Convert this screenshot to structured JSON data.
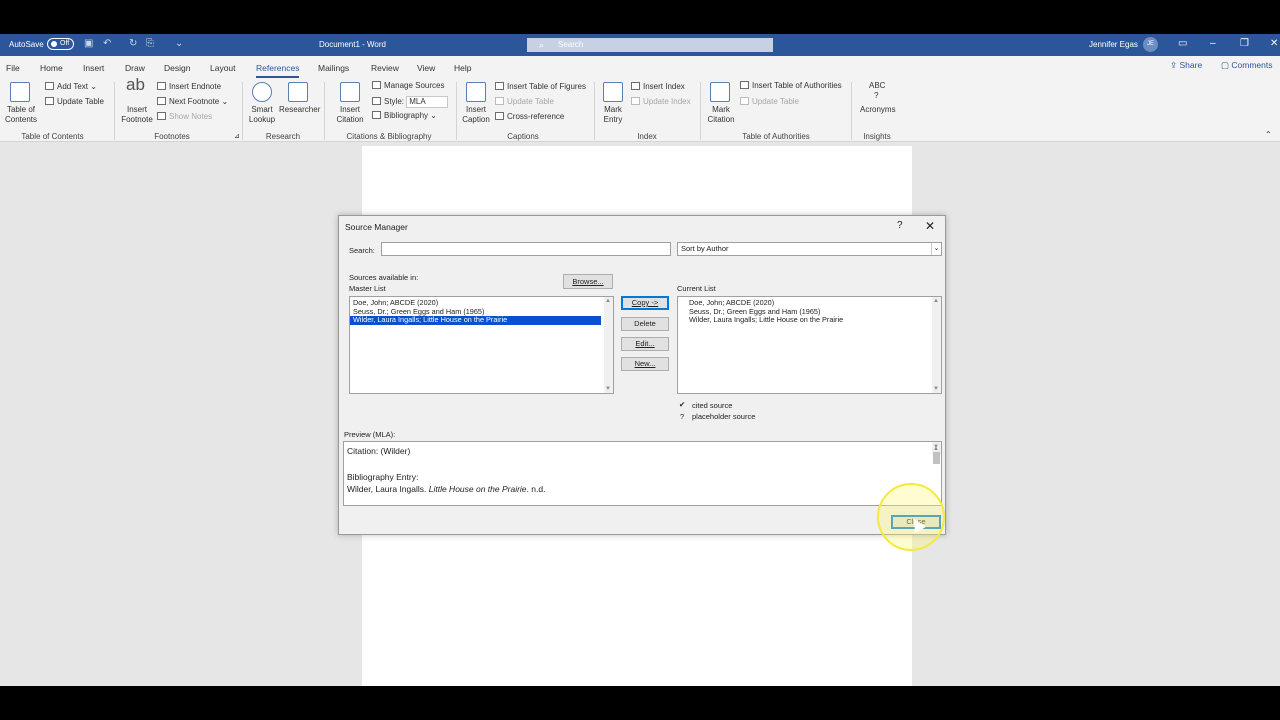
{
  "titlebar": {
    "autosave_label": "AutoSave",
    "autosave_state": "Off",
    "document_title": "Document1  -  Word",
    "search_placeholder": "Search",
    "user_name": "Jennifer Egas",
    "user_initials": "JE"
  },
  "menu": {
    "items": [
      "File",
      "Home",
      "Insert",
      "Draw",
      "Design",
      "Layout",
      "References",
      "Mailings",
      "Review",
      "View",
      "Help"
    ],
    "active": "References",
    "share": "Share",
    "comments": "Comments"
  },
  "ribbon": {
    "toc": {
      "big": "Table of Contents",
      "add_text": "Add Text",
      "update_table": "Update Table",
      "group": "Table of Contents"
    },
    "footnotes": {
      "insert_footnote": "Insert Footnote",
      "insert_endnote": "Insert Endnote",
      "next_footnote": "Next Footnote",
      "show_notes": "Show Notes",
      "group": "Footnotes",
      "ab": "ab"
    },
    "research": {
      "smart_lookup": "Smart Lookup",
      "researcher": "Researcher",
      "group": "Research"
    },
    "citations": {
      "insert_citation": "Insert Citation",
      "manage_sources": "Manage Sources",
      "style_label": "Style:",
      "style_value": "MLA",
      "bibliography": "Bibliography",
      "group": "Citations & Bibliography"
    },
    "captions": {
      "insert_caption": "Insert Caption",
      "insert_table_of_figures": "Insert Table of Figures",
      "update_table": "Update Table",
      "cross_reference": "Cross-reference",
      "group": "Captions"
    },
    "index": {
      "mark_entry": "Mark Entry",
      "insert_index": "Insert Index",
      "update_index": "Update Index",
      "group": "Index"
    },
    "toa": {
      "mark_citation": "Mark Citation",
      "insert_toa": "Insert Table of Authorities",
      "update_table": "Update Table",
      "group": "Table of Authorities"
    },
    "insights": {
      "abc": "ABC",
      "acronyms": "Acronyms",
      "group": "Insights"
    }
  },
  "dialog": {
    "title": "Source Manager",
    "help": "?",
    "close_x": "✕",
    "search_label": "Search:",
    "search_value": "",
    "sort_value": "Sort by Author",
    "sources_available": "Sources available in:",
    "master_list": "Master List",
    "browse": "Browse...",
    "current_list": "Current List",
    "master_items": [
      "Doe, John; ABCDE (2020)",
      "Seuss, Dr.; Green Eggs and Ham (1965)",
      "Wilder, Laura Ingalls; Little House on the Prairie"
    ],
    "current_items": [
      "Doe, John; ABCDE (2020)",
      "Seuss, Dr.; Green Eggs and Ham (1965)",
      "Wilder, Laura Ingalls; Little House on the Prairie"
    ],
    "buttons": {
      "copy": "Copy ->",
      "delete": "Delete",
      "edit": "Edit...",
      "new": "New..."
    },
    "legend": {
      "cited_mark": "✔",
      "cited": "cited source",
      "placeholder_mark": "?",
      "placeholder": "placeholder source"
    },
    "preview_label": "Preview (MLA):",
    "preview": {
      "citation": "Citation:  (Wilder)",
      "bib_label": "Bibliography Entry:",
      "bib_author": "Wilder, Laura Ingalls. ",
      "bib_title": "Little House on the Prairie",
      "bib_tail": ". n.d."
    },
    "close_button": "Close"
  }
}
